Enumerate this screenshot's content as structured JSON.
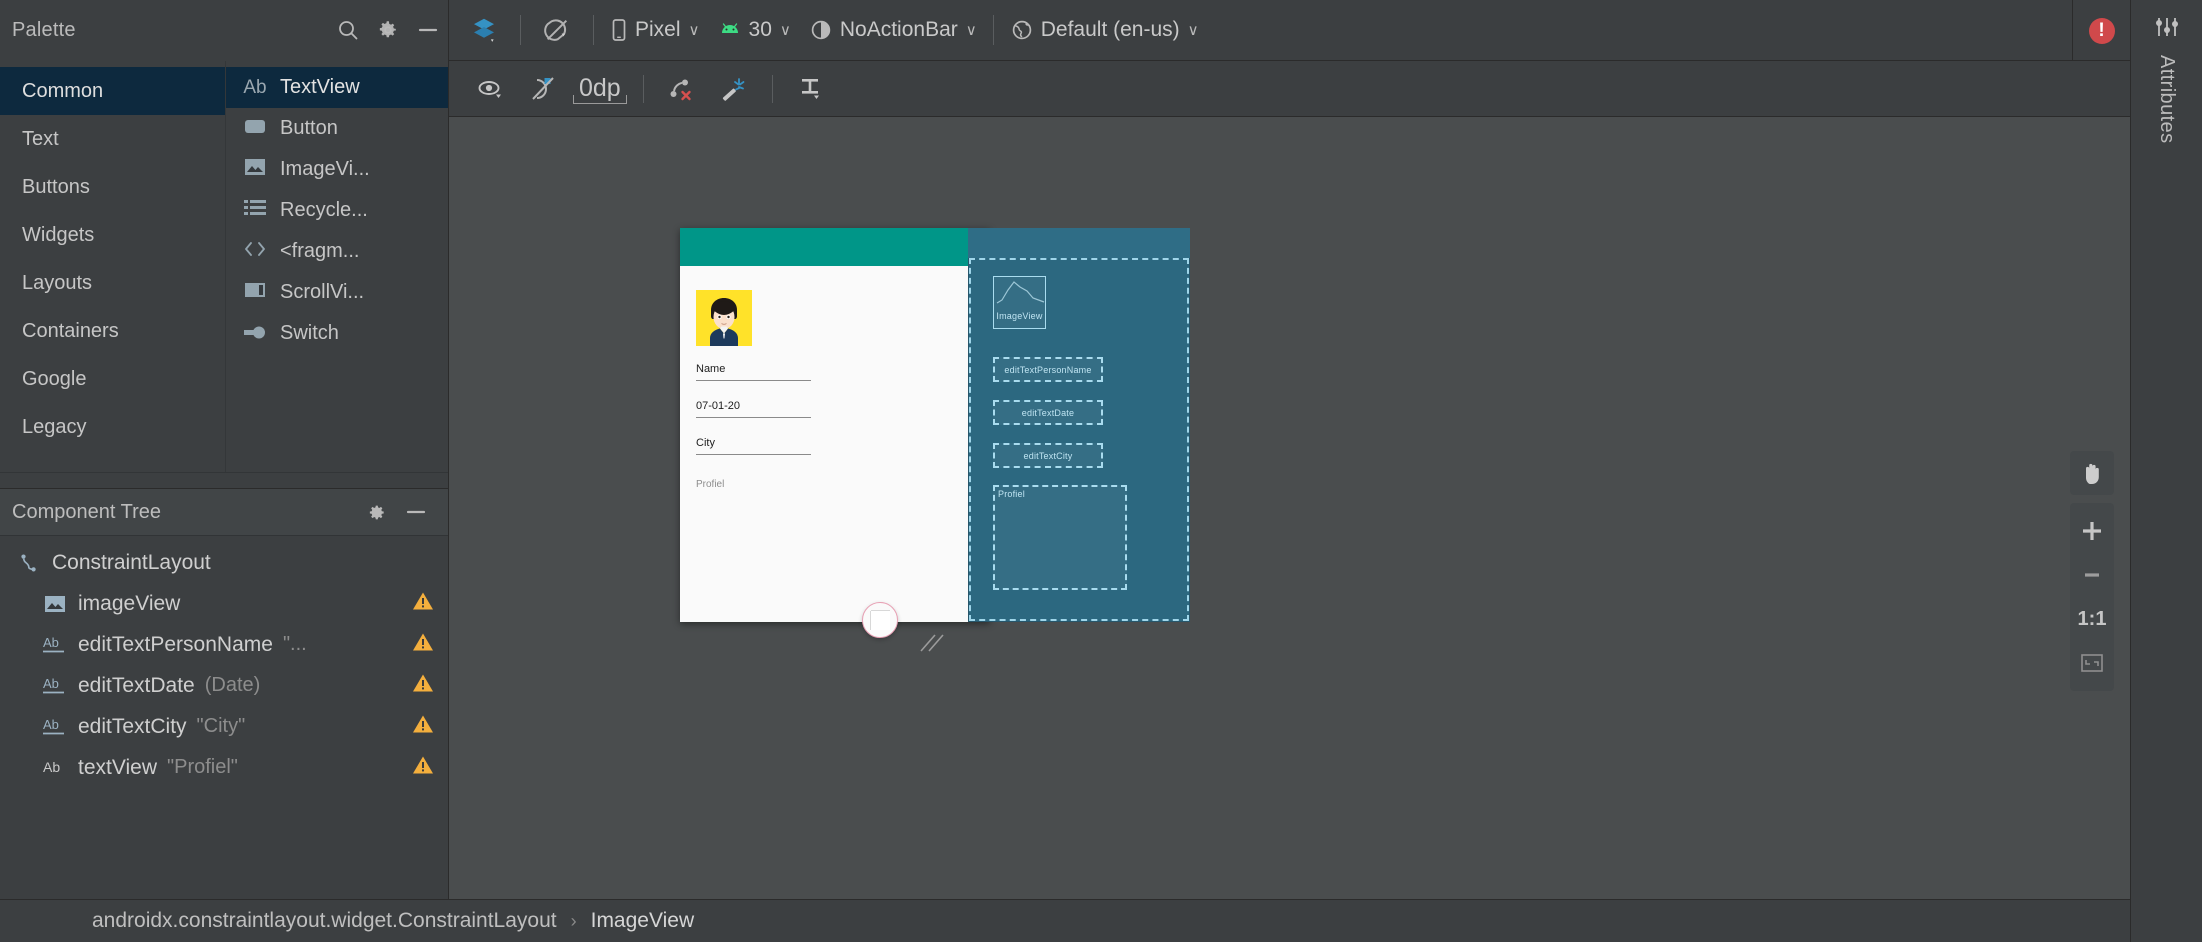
{
  "window": {
    "error_badge": "!"
  },
  "palette": {
    "title": "Palette",
    "search_icon": "search-icon",
    "gear_icon": "gear-icon",
    "minimize_icon": "minimize-icon",
    "categories": [
      {
        "label": "Common",
        "selected": true
      },
      {
        "label": "Text",
        "selected": false
      },
      {
        "label": "Buttons",
        "selected": false
      },
      {
        "label": "Widgets",
        "selected": false
      },
      {
        "label": "Layouts",
        "selected": false
      },
      {
        "label": "Containers",
        "selected": false
      },
      {
        "label": "Google",
        "selected": false
      },
      {
        "label": "Legacy",
        "selected": false
      }
    ],
    "items": [
      {
        "label": "TextView",
        "icon": "ab-text-icon",
        "selected": true
      },
      {
        "label": "Button",
        "icon": "button-icon",
        "selected": false
      },
      {
        "label": "ImageVi...",
        "icon": "image-icon",
        "selected": false
      },
      {
        "label": "Recycle...",
        "icon": "list-icon",
        "selected": false
      },
      {
        "label": "<fragm...",
        "icon": "code-brackets-icon",
        "selected": false
      },
      {
        "label": "ScrollVi...",
        "icon": "scrollview-icon",
        "selected": false
      },
      {
        "label": "Switch",
        "icon": "switch-icon",
        "selected": false
      }
    ]
  },
  "component_tree": {
    "title": "Component Tree",
    "gear_icon": "gear-icon",
    "minimize_icon": "minimize-icon",
    "nodes": [
      {
        "label": "ConstraintLayout",
        "value": "",
        "icon": "constraint-layout-icon",
        "depth": 0,
        "warning": false
      },
      {
        "label": "imageView",
        "value": "",
        "icon": "image-icon",
        "depth": 1,
        "warning": true
      },
      {
        "label": "editTextPersonName",
        "value": "\"...",
        "icon": "ab-underline-icon",
        "depth": 1,
        "warning": true
      },
      {
        "label": "editTextDate",
        "value": "(Date)",
        "icon": "ab-underline-icon",
        "depth": 1,
        "warning": true
      },
      {
        "label": "editTextCity",
        "value": "\"City\"",
        "icon": "ab-underline-icon",
        "depth": 1,
        "warning": true
      },
      {
        "label": "textView",
        "value": "\"Profiel\"",
        "icon": "ab-text-icon",
        "depth": 1,
        "warning": true
      }
    ]
  },
  "toolbar": {
    "design_mode_icon": "layers-icon",
    "orientation_icon": "rotate-device-icon",
    "device": {
      "label": "Pixel",
      "icon": "phone-icon",
      "caret": "∨"
    },
    "api": {
      "label": "30",
      "icon": "android-icon",
      "caret": "∨"
    },
    "theme": {
      "label": "NoActionBar",
      "icon": "theme-contrast-icon",
      "caret": "∨"
    },
    "locale": {
      "label": "Default (en-us)",
      "icon": "globe-icon",
      "caret": "∨"
    }
  },
  "design_toolbar": {
    "visibility_icon": "eye-icon",
    "autoconnect_icon": "autoconnect-off-icon",
    "default_margin": "0dp",
    "clear_constraints_icon": "clear-constraints-icon",
    "infer_constraints_icon": "magic-wand-icon",
    "align_icon": "align-vertical-icon"
  },
  "preview": {
    "appbar_color": "#009688",
    "avatar_bg": "#ffe229",
    "fields": [
      {
        "label": "Name"
      },
      {
        "label": "07-01-20"
      },
      {
        "label": "City"
      }
    ],
    "profiel_label": "Profiel"
  },
  "blueprint": {
    "imageview_label": "ImageView",
    "boxes": [
      {
        "label": "editTextPersonName"
      },
      {
        "label": "editTextDate"
      },
      {
        "label": "editTextCity"
      }
    ],
    "profiel_label": "Profiel"
  },
  "zoom_controls": {
    "pan_icon": "hand-pan-icon",
    "zoom_in": "+",
    "zoom_out": "−",
    "actual_size": "1:1",
    "fit_icon": "fit-screen-icon"
  },
  "breadcrumb": {
    "root": "androidx.constraintlayout.widget.ConstraintLayout",
    "separator": "›",
    "leaf": "ImageView"
  },
  "attributes_panel": {
    "label": "Attributes",
    "icon": "sliders-icon"
  }
}
